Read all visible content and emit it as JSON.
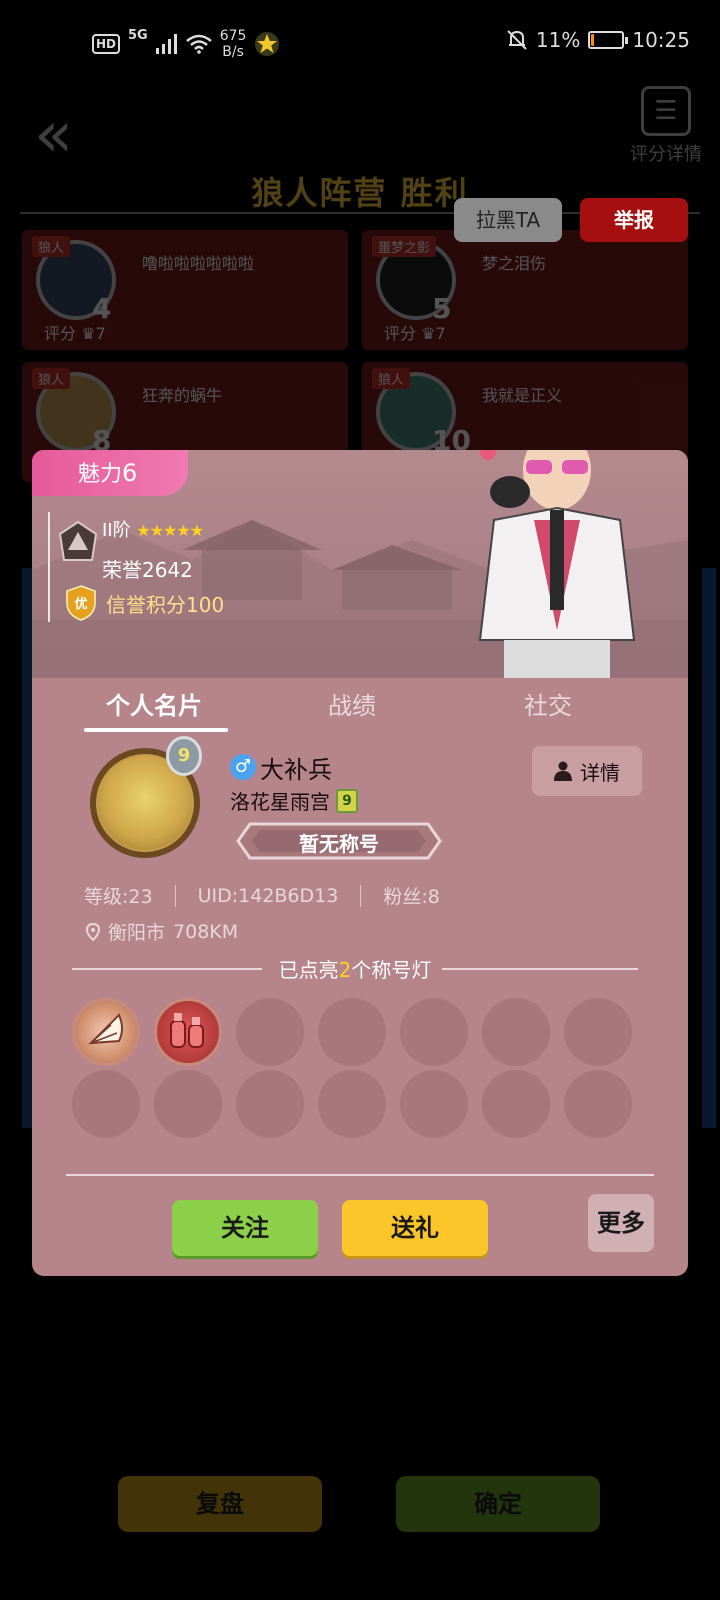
{
  "status_bar": {
    "hd": "HD",
    "signal": "5G",
    "net_speed_value": "675",
    "net_speed_unit": "B/s",
    "battery_percent": "11%",
    "battery_level": 0.11,
    "time": "10:25"
  },
  "background": {
    "rating_detail_label": "评分详情",
    "result_title": "狼人阵营  胜利",
    "players": [
      {
        "tag": "狼人",
        "name": "噜啦啦啦啦啦啦",
        "number": "4",
        "score_label": "评分",
        "score": "7"
      },
      {
        "tag": "噩梦之影",
        "name": "梦之泪伤",
        "number": "5",
        "score_label": "评分",
        "score": "7"
      },
      {
        "tag": "狼人",
        "name": "狂奔的蜗牛",
        "number": "8",
        "score_label": "",
        "score": ""
      },
      {
        "tag": "狼人",
        "name": "我就是正义",
        "number": "10",
        "score_label": "",
        "score": ""
      }
    ],
    "replay_label": "复盘",
    "confirm_label": "确定"
  },
  "actions": {
    "blacklist_label": "拉黑TA",
    "report_label": "举报"
  },
  "profile": {
    "charm_label": "魅力",
    "charm_value": "6",
    "rank_level": "II阶",
    "rank_stars": 5,
    "honor_label": "荣誉",
    "honor_value": "2642",
    "credit_badge": "优",
    "credit_label": "信誉积分",
    "credit_value": "100",
    "tabs": [
      {
        "label": "个人名片"
      },
      {
        "label": "战绩"
      },
      {
        "label": "社交"
      }
    ],
    "avatar_level": "9",
    "gender_symbol": "♂",
    "name": "大补兵",
    "guild_name": "洛花星雨宫",
    "guild_level": "9",
    "detail_label": "详情",
    "title_placeholder": "暂无称号",
    "stats": {
      "level": "等级:23",
      "uid": "UID:142B6D13",
      "fans": "粉丝:8"
    },
    "location_city": "衡阳市",
    "location_distance": "708KM",
    "lit_prefix": "已点亮",
    "lit_count": "2",
    "lit_suffix": "个称号灯",
    "follow_label": "关注",
    "gift_label": "送礼",
    "more_label": "更多"
  }
}
